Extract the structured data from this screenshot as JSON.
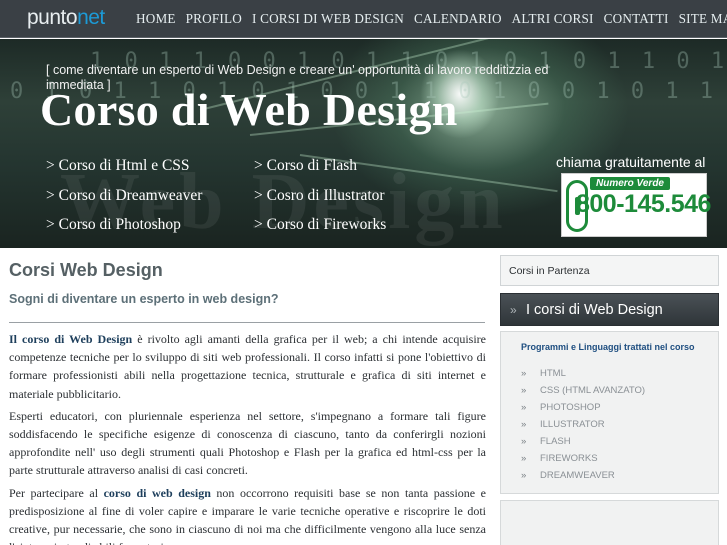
{
  "logo": {
    "part1": "punto",
    "part2": "net"
  },
  "nav": {
    "items": [
      "HOME",
      "PROFILO",
      "I CORSI DI WEB DESIGN",
      "CALENDARIO",
      "ALTRI CORSI",
      "CONTATTI",
      "SITE MAP"
    ]
  },
  "hero": {
    "tagline": "[ come diventare un esperto di Web Design e creare un' opportunità di lavoro redditizzia ed immediata ]",
    "title": "Corso di Web Design",
    "courses_left": [
      "> Corso di Html e CSS",
      "> Corso di Dreamweaver",
      "> Corso di Photoshop"
    ],
    "courses_right": [
      "> Corso di Flash",
      "> Cosro di Illustrator",
      "> Corso di Fireworks"
    ],
    "call_label": "chiama gratuitamente al",
    "numero_verde_tag": "Numero Verde",
    "numero_verde": "800-145.546",
    "background_word": "Web Design"
  },
  "main": {
    "title": "Corsi Web Design",
    "subtitle": "Sogni di diventare un esperto in web design?",
    "p1_bold": "Il corso di Web Design",
    "p1_rest": " è rivolto agli amanti della grafica per il web; a chi intende acquisire competenze tecniche per lo sviluppo di siti web professionali. Il corso infatti si pone l'obiettivo di formare professionisti abili nella progettazione tecnica, strutturale e grafica di siti internet e materiale pubblicitario.",
    "p2": "Esperti educatori, con pluriennale esperienza nel settore, s'impegnano a formare tali figure soddisfacendo le specifiche esigenze di conoscenza di ciascuno, tanto da conferirgli nozioni approfondite nell' uso degli strumenti quali Photoshop e Flash per la grafica ed html-css per la parte strutturale attraverso analisi di casi concreti.",
    "p3_start": "Per partecipare al ",
    "p3_bold": "corso di web design",
    "p3_rest": " non occorrono requisiti base se non tanta passione e predisposizione al fine di voler capire e imparare le varie tecniche operative e riscoprire le doti creative, pur necessarie, che sono in ciascuno di noi ma che difficilmente vengono alla luce senza l'aiuto, mirato, di abili formatori."
  },
  "sidebar": {
    "box1": "Corsi in Partenza",
    "box2_arrow": "»",
    "box2": "I corsi di Web Design",
    "box3_head": "Programmi e Linguaggi trattati nel corso",
    "bullet": "»",
    "items": [
      "HTML",
      "CSS (HTML AVANZATO)",
      "PHOTOSHOP",
      "ILLUSTRATOR",
      "FLASH",
      "FIREWORKS",
      "DREAMWEAVER"
    ]
  },
  "colors": {
    "topbar": "#3a4045",
    "accent_blue": "#1c9ad6",
    "numero_green": "#1d8b3a",
    "title_gray": "#556064",
    "sidebar_head_blue": "#1e4e80"
  }
}
